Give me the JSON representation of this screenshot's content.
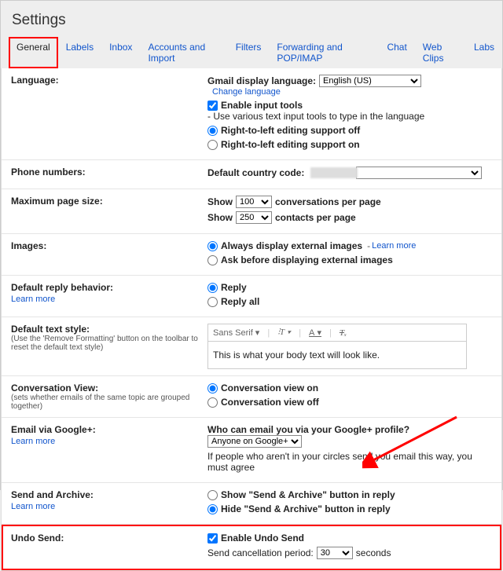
{
  "page_title": "Settings",
  "tabs": [
    "General",
    "Labels",
    "Inbox",
    "Accounts and Import",
    "Filters",
    "Forwarding and POP/IMAP",
    "Chat",
    "Web Clips",
    "Labs"
  ],
  "language": {
    "title": "Language:",
    "display_label": "Gmail display language:",
    "display_value": "English (US)",
    "change_link": "Change language",
    "enable_tools_label": "Enable input tools",
    "enable_tools_desc": " - Use various text input tools to type in the language",
    "rtl_off": "Right-to-left editing support off",
    "rtl_on": "Right-to-left editing support on"
  },
  "phone": {
    "title": "Phone numbers:",
    "country_label": "Default country code:"
  },
  "pagesize": {
    "title": "Maximum page size:",
    "show": "Show",
    "conv_count": "100",
    "conv_suffix": "conversations per page",
    "contacts_count": "250",
    "contacts_suffix": "contacts per page"
  },
  "images": {
    "title": "Images:",
    "always": "Always display external images",
    "ask": "Ask before displaying external images",
    "learn": "Learn more"
  },
  "reply": {
    "title": "Default reply behavior:",
    "learn": "Learn more",
    "reply": "Reply",
    "replyall": "Reply all"
  },
  "textstyle": {
    "title": "Default text style:",
    "sub": "(Use the 'Remove Formatting' button on the toolbar to reset the default text style)",
    "font": "Sans Serif",
    "sample": "This is what your body text will look like."
  },
  "conv": {
    "title": "Conversation View:",
    "sub": "(sets whether emails of the same topic are grouped together)",
    "on": "Conversation view on",
    "off": "Conversation view off"
  },
  "gplus": {
    "title": "Email via Google+:",
    "learn": "Learn more",
    "who": "Who can email you via your Google+ profile?",
    "selected": "Anyone on Google+",
    "desc": "If people who aren't in your circles send you email this way, you must agree"
  },
  "sendarchive": {
    "title": "Send and Archive:",
    "learn": "Learn more",
    "show": "Show \"Send & Archive\" button in reply",
    "hide": "Hide \"Send & Archive\" button in reply"
  },
  "undo": {
    "title": "Undo Send:",
    "enable": "Enable Undo Send",
    "cancel_label": "Send cancellation period:",
    "value": "30",
    "suffix": "seconds"
  }
}
